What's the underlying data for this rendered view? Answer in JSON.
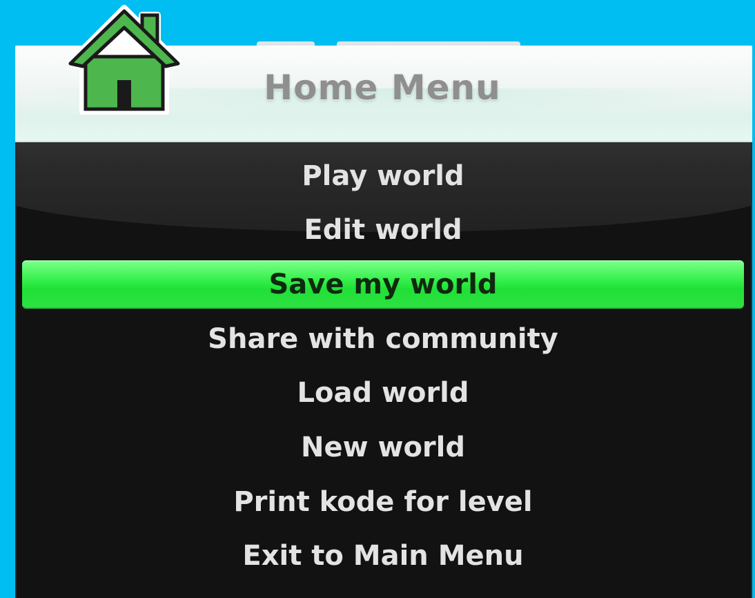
{
  "window": {
    "title": "Home Menu",
    "icon": "house-icon"
  },
  "colors": {
    "background": "#00bdf2",
    "selected_highlight": "#2ee043",
    "menu_panel": "#121212",
    "house_green": "#4db64d"
  },
  "menu": {
    "selected_index": 2,
    "items": [
      {
        "label": "Play world"
      },
      {
        "label": "Edit world"
      },
      {
        "label": "Save my world"
      },
      {
        "label": "Share with community"
      },
      {
        "label": "Load world"
      },
      {
        "label": "New world"
      },
      {
        "label": "Print kode for level"
      },
      {
        "label": "Exit to Main Menu"
      }
    ]
  }
}
